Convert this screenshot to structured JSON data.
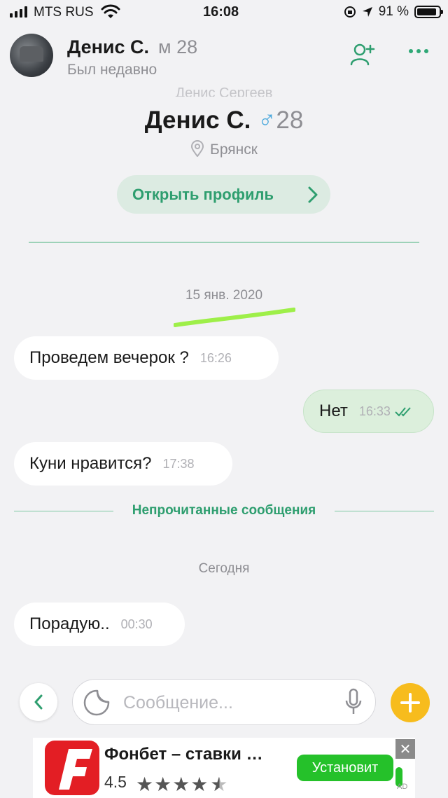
{
  "status_bar": {
    "carrier": "MTS RUS",
    "time": "16:08",
    "battery": "91 %",
    "battery_level": 0.91
  },
  "header": {
    "name": "Денис С.",
    "gender_age": "м 28",
    "last_seen": "Был недавно"
  },
  "profile": {
    "full_name_ghost": "Денис Сергеев",
    "name": "Денис С.",
    "sex_symbol": "♂",
    "age": "28",
    "city": "Брянск",
    "open_profile_label": "Открыть профиль"
  },
  "messages": {
    "date_1": "15 янв. 2020",
    "m1": {
      "text": "Проведем вечерок ?",
      "time": "16:26"
    },
    "m2": {
      "text": "Нет",
      "time": "16:33"
    },
    "m3": {
      "text": "Куни нравится?",
      "time": "17:38"
    },
    "unread_label": "Непрочитанные сообщения",
    "date_2": "Сегодня",
    "m4": {
      "text": "Порадую..",
      "time": "00:30"
    }
  },
  "composer": {
    "placeholder": "Сообщение..."
  },
  "ad": {
    "title": "Фонбет – ставки …",
    "rating": "4.5",
    "rating_value": 4.5,
    "install_label": "Установит",
    "tag": "AD"
  },
  "colors": {
    "accent": "#2e9e6f",
    "outgoing_bubble": "#dcefdc",
    "plus_button": "#f7bc1d",
    "ad_logo": "#e31e24",
    "install_button": "#25c12a"
  }
}
